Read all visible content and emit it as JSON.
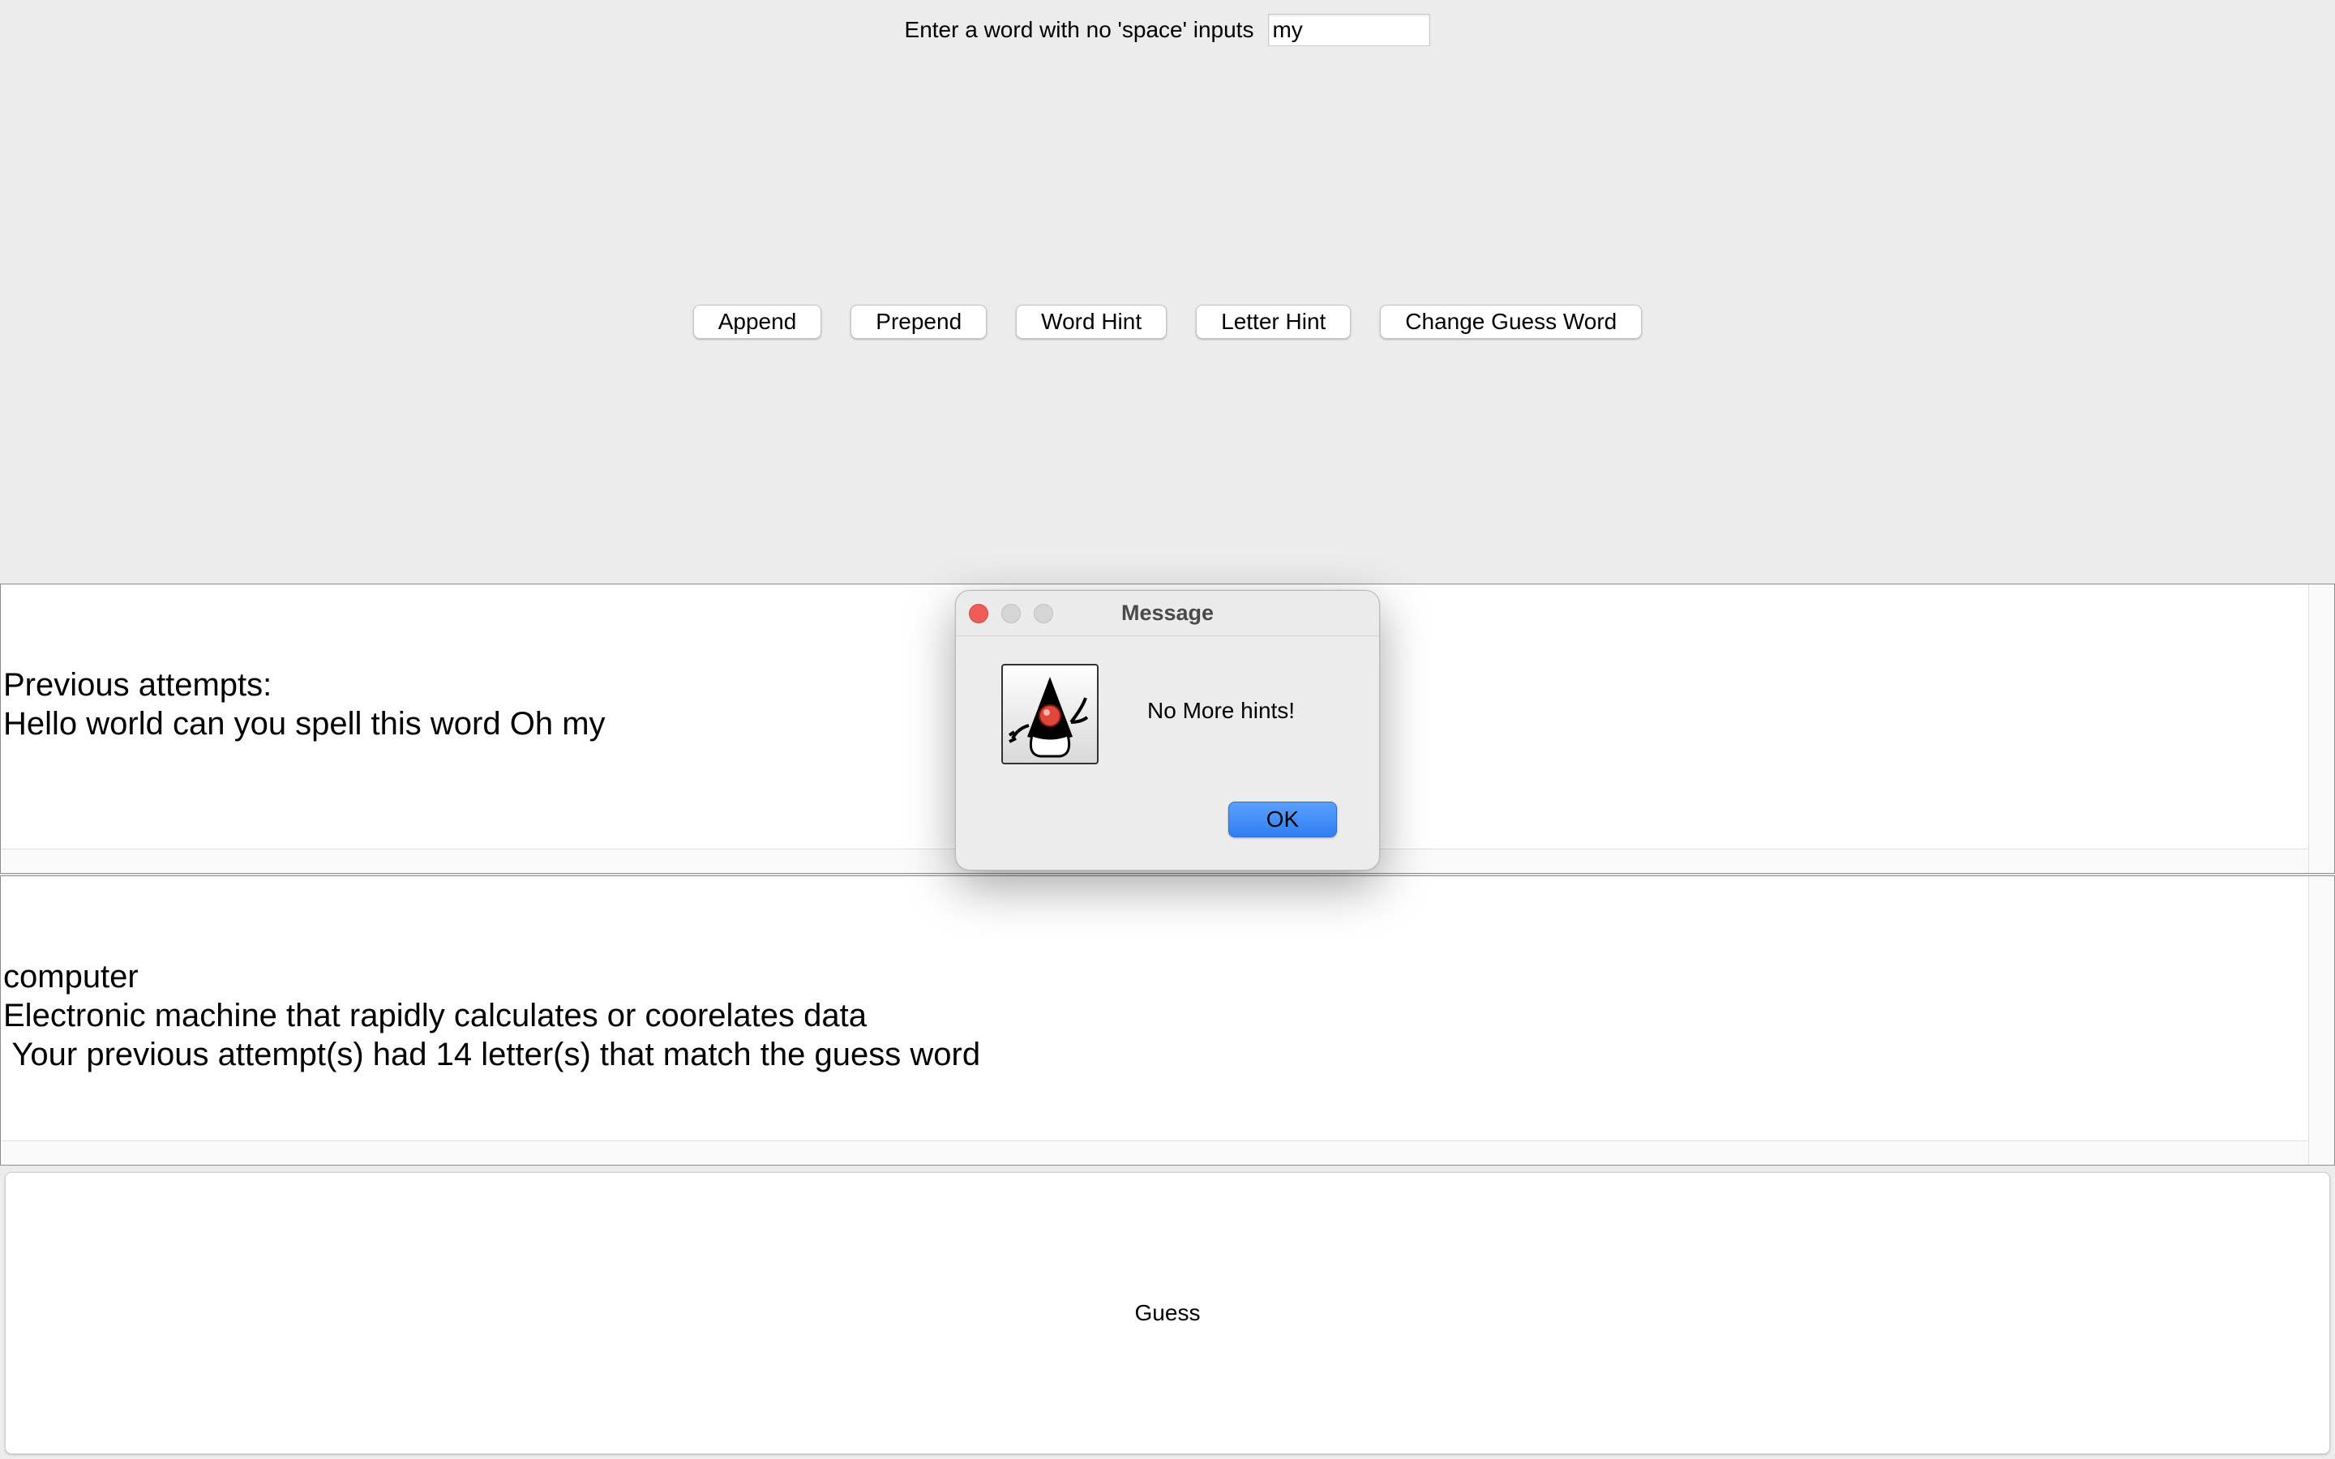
{
  "prompt": {
    "label": "Enter a word with no 'space' inputs",
    "input_value": "my"
  },
  "buttons": {
    "append": "Append",
    "prepend": "Prepend",
    "word_hint": "Word Hint",
    "letter_hint": "Letter Hint",
    "change_guess_word": "Change Guess Word"
  },
  "attempts_panel": {
    "text": "Previous attempts:\nHello world can you spell this word Oh my"
  },
  "hint_panel": {
    "text": "computer\nElectronic machine that rapidly calculates or coorelates data\n Your previous attempt(s) had 14 letter(s) that match the guess word"
  },
  "guess_button": {
    "label": "Guess"
  },
  "dialog": {
    "title": "Message",
    "message": "No More hints!",
    "ok_label": "OK",
    "icon": "java-duke-icon"
  }
}
